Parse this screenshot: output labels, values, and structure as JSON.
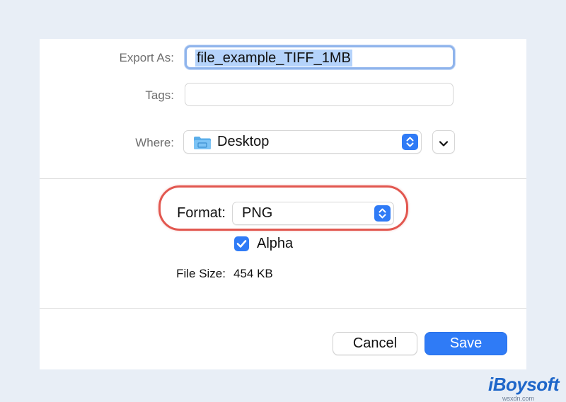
{
  "export": {
    "label": "Export As:",
    "value": "file_example_TIFF_1MB"
  },
  "tags": {
    "label": "Tags:",
    "value": ""
  },
  "where": {
    "label": "Where:",
    "value": "Desktop",
    "folder_icon": "folder-icon"
  },
  "format": {
    "label": "Format:",
    "value": "PNG"
  },
  "alpha": {
    "label": "Alpha",
    "checked": true
  },
  "file_size": {
    "label": "File Size:",
    "value": "454 KB"
  },
  "buttons": {
    "cancel": "Cancel",
    "save": "Save"
  },
  "watermark": {
    "brand": "iBoysoft",
    "site": "wsxdn.com"
  },
  "colors": {
    "accent": "#2f7bf6",
    "highlight": "#e2574f",
    "selection": "#b5d3fb"
  }
}
